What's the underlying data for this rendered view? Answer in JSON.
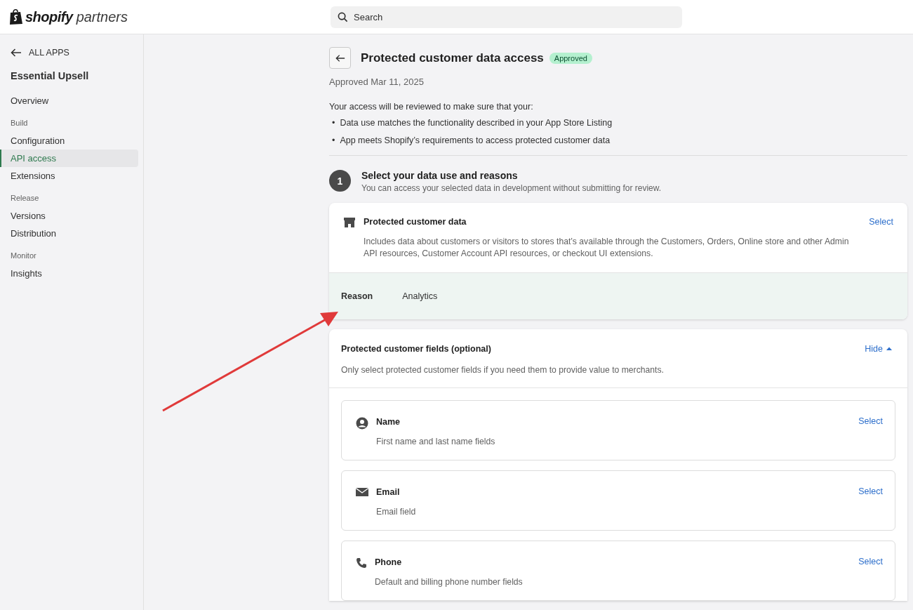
{
  "header": {
    "logo_bold": "shopify",
    "logo_light": "partners",
    "search": {
      "placeholder": "Search"
    }
  },
  "sidebar": {
    "items": [
      {
        "kind": "back",
        "label": "ALL APPS"
      },
      {
        "kind": "title",
        "label": "Essential Upsell"
      },
      {
        "kind": "link",
        "label": "Overview",
        "selected": false
      },
      {
        "kind": "heading",
        "label": "Build"
      },
      {
        "kind": "link",
        "label": "Configuration",
        "selected": false
      },
      {
        "kind": "link",
        "label": "API access",
        "selected": true
      },
      {
        "kind": "link",
        "label": "Extensions",
        "selected": false
      },
      {
        "kind": "heading",
        "label": "Release"
      },
      {
        "kind": "link",
        "label": "Versions",
        "selected": false
      },
      {
        "kind": "link",
        "label": "Distribution",
        "selected": false
      },
      {
        "kind": "heading",
        "label": "Monitor"
      },
      {
        "kind": "link",
        "label": "Insights",
        "selected": false
      }
    ]
  },
  "page": {
    "title": "Protected customer data access",
    "badge": "Approved",
    "subtitle": "Approved Mar 11, 2025",
    "intro": "Your access will be reviewed to make sure that your:",
    "bullets": [
      {
        "marker": "•",
        "text": "Data use matches the functionality described in your App Store Listing"
      },
      {
        "marker": "•",
        "text": "App meets Shopify’s requirements to access protected customer data"
      }
    ],
    "step": {
      "number": "1",
      "title": "Select your data use and reasons",
      "subtitle": "You can access your selected data in development without submitting for review."
    },
    "data_card": {
      "title": "Protected customer data",
      "action": "Select",
      "description": "Includes data about customers or visitors to stores that’s available through the Customers, Orders, Online store and other Admin API resources, Customer Account API resources, or checkout UI extensions.",
      "reason_label": "Reason",
      "reason_value": "Analytics"
    },
    "fields_card": {
      "title": "Protected customer fields (optional)",
      "toggle": "Hide",
      "expanded": true,
      "description": "Only select protected customer fields if you need them to provide value to merchants.",
      "fields": [
        {
          "kind": "person",
          "title": "Name",
          "description": "First name and last name fields",
          "action": "Select"
        },
        {
          "kind": "mail",
          "title": "Email",
          "description": "Email field",
          "action": "Select"
        },
        {
          "kind": "phone",
          "title": "Phone",
          "description": "Default and billing phone number fields",
          "action": "Select"
        }
      ]
    }
  }
}
